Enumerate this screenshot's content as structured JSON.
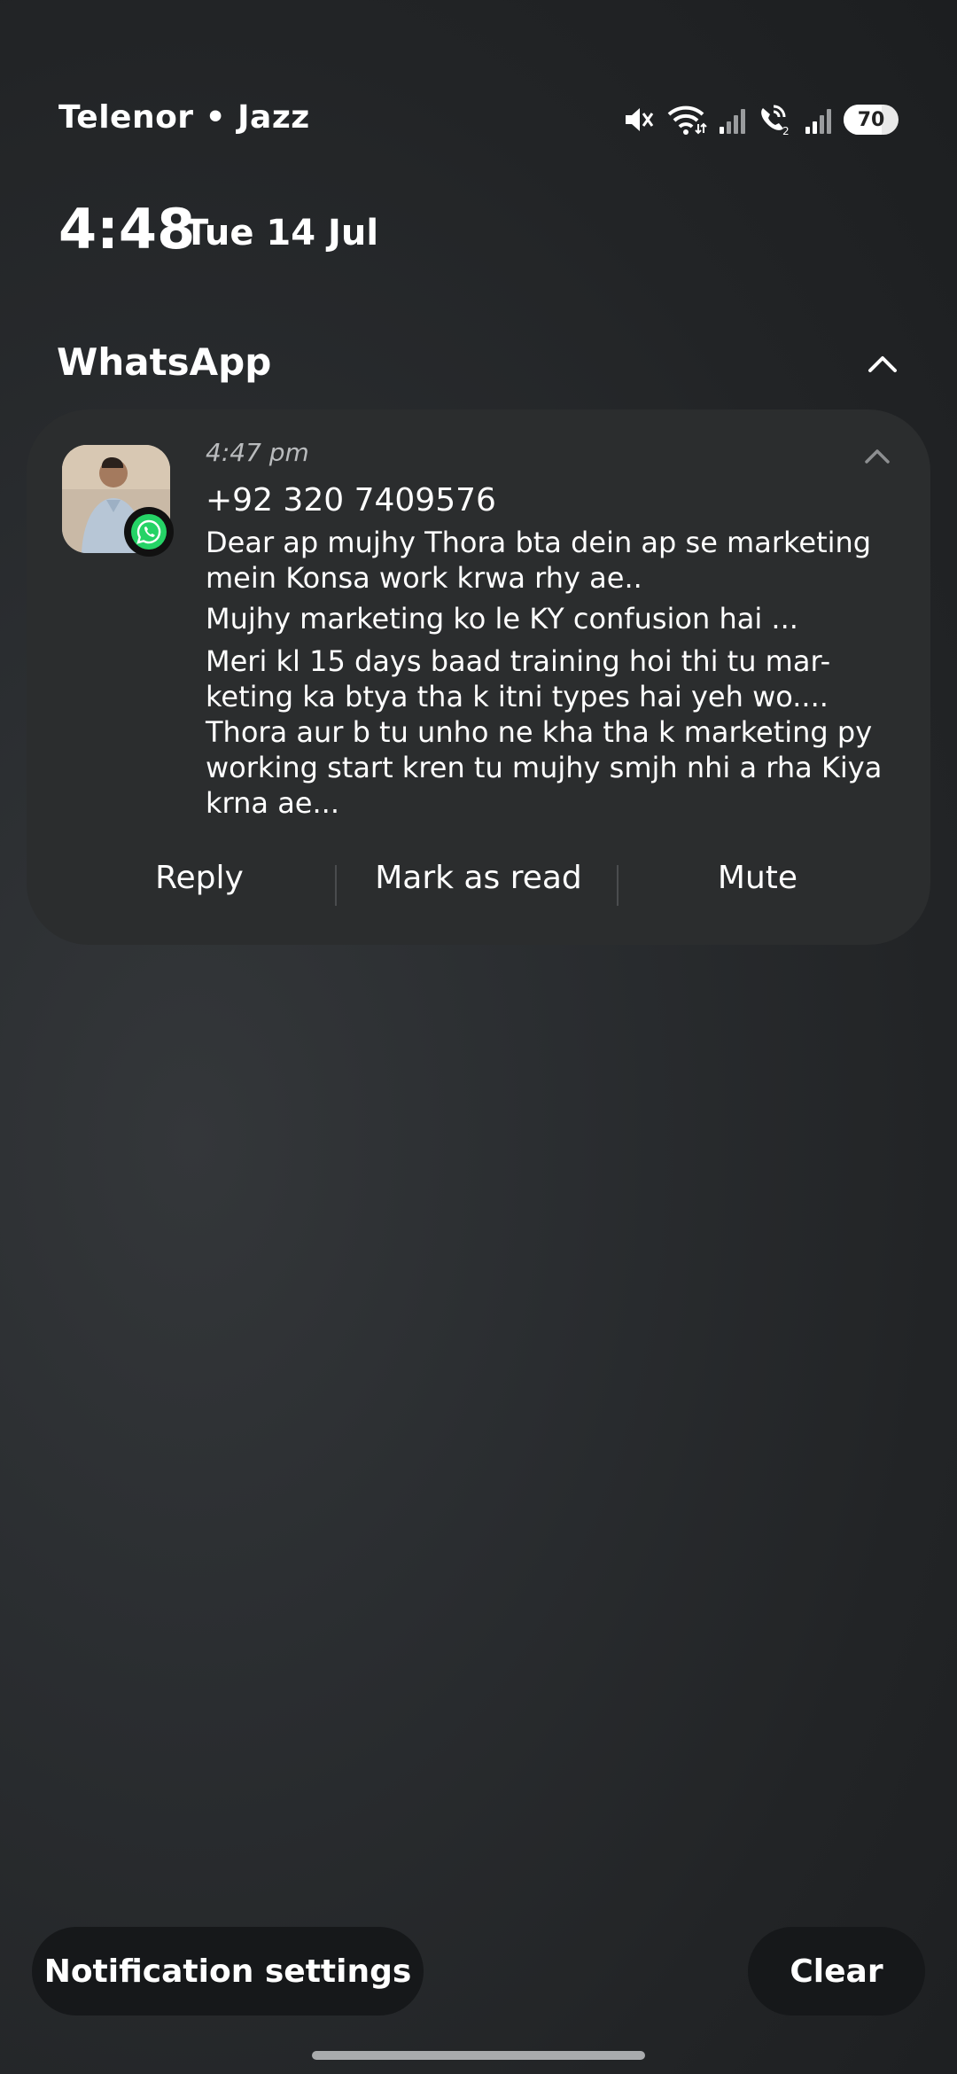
{
  "status_bar": {
    "carrier": "Telenor • Jazz",
    "battery": "70",
    "icons": [
      "mute-icon",
      "wifi-icon",
      "signal-icon",
      "wifi-calling-icon",
      "signal-icon"
    ]
  },
  "lockscreen": {
    "time": "4:48",
    "date": "Tue 14 Jul"
  },
  "group": {
    "app_name": "WhatsApp"
  },
  "notification": {
    "time": "4:47 pm",
    "sender": "+92 320 7409576",
    "messages": [
      "Dear ap mujhy Thora bta dein ap se marketing mein Konsa work krwa rhy ae..",
      "Mujhy marketing ko le KY confusion hai ...",
      "Meri kl 15 days baad training hoi thi tu mar-keting ka btya tha k itni types hai yeh wo.... Thora aur b tu unho ne kha tha k marketing py working start kren tu mujhy smjh nhi a rha Kiya krna ae..."
    ],
    "actions": {
      "reply": "Reply",
      "mark_read": "Mark as read",
      "mute": "Mute"
    }
  },
  "footer": {
    "settings_label": "Notification settings",
    "clear_label": "Clear"
  },
  "colors": {
    "whatsapp_green": "#25D366",
    "card_bg": "#2b2d2e"
  }
}
